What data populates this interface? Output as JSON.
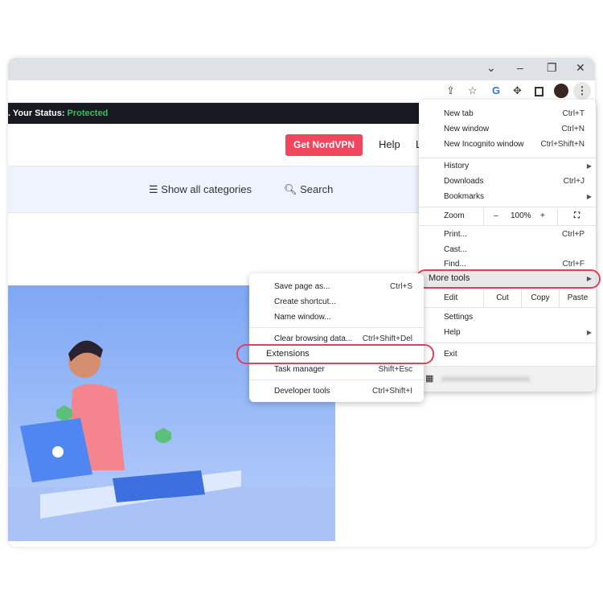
{
  "window_controls": {
    "dropdown": "⌄",
    "minimize": "–",
    "restore": "❐",
    "close": "✕"
  },
  "toolbar_icons": [
    "share-icon",
    "star-icon",
    "translate-extension-icon",
    "extensions-puzzle-icon",
    "side-panel-icon",
    "profile-avatar",
    "more-menu-icon"
  ],
  "banner": {
    "prefix": ". Your Status: ",
    "status": "Protected"
  },
  "header": {
    "cta": "Get NordVPN",
    "help": "Help",
    "partial": "L"
  },
  "nav": {
    "categories": "Show all categories",
    "search": "Search"
  },
  "menu": {
    "group1": [
      {
        "label": "New tab",
        "shortcut": "Ctrl+T"
      },
      {
        "label": "New window",
        "shortcut": "Ctrl+N"
      },
      {
        "label": "New Incognito window",
        "shortcut": "Ctrl+Shift+N"
      }
    ],
    "group2": [
      {
        "label": "History",
        "shortcut": ""
      },
      {
        "label": "Downloads",
        "shortcut": "Ctrl+J"
      },
      {
        "label": "Bookmarks",
        "shortcut": ""
      }
    ],
    "zoom": {
      "label": "Zoom",
      "minus": "–",
      "value": "100%",
      "plus": "+"
    },
    "group3": [
      {
        "label": "Print...",
        "shortcut": "Ctrl+P"
      },
      {
        "label": "Cast...",
        "shortcut": ""
      },
      {
        "label": "Find...",
        "shortcut": "Ctrl+F"
      },
      {
        "label": "More tools",
        "shortcut": ""
      }
    ],
    "edit": {
      "label": "Edit",
      "cut": "Cut",
      "copy": "Copy",
      "paste": "Paste"
    },
    "group4": [
      {
        "label": "Settings"
      },
      {
        "label": "Help"
      }
    ],
    "exit": "Exit"
  },
  "submenu": {
    "items": [
      {
        "label": "Save page as...",
        "shortcut": "Ctrl+S"
      },
      {
        "label": "Create shortcut...",
        "shortcut": ""
      },
      {
        "label": "Name window...",
        "shortcut": ""
      },
      {
        "label": "Clear browsing data...",
        "shortcut": "Ctrl+Shift+Del"
      },
      {
        "label": "Extensions",
        "shortcut": ""
      },
      {
        "label": "Task manager",
        "shortcut": "Shift+Esc"
      },
      {
        "label": "Developer tools",
        "shortcut": "Ctrl+Shift+I"
      }
    ]
  },
  "colors": {
    "highlight": "#e0405a",
    "cta": "#f0475f",
    "protected": "#3dbd5a"
  }
}
